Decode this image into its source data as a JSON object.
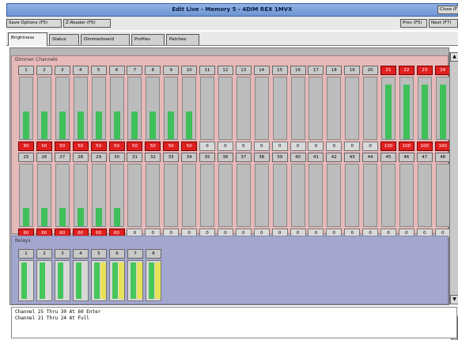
{
  "window": {
    "title": "Edit Live - Memory 5 - 4DIM REX 1MVX"
  },
  "toolbar": {
    "close_label": "Close (F)",
    "save_label": "Save Options (F5)",
    "zreader_label": "Z-Reader (F6)",
    "prev_label": "Prev (F5)",
    "next_label": "Next (F7)"
  },
  "tabs": [
    {
      "label": "Brightness",
      "active": true
    },
    {
      "label": "Status",
      "active": false
    },
    {
      "label": "Dimmerboard",
      "active": false
    },
    {
      "label": "Profiles",
      "active": false
    },
    {
      "label": "Patches",
      "active": false
    }
  ],
  "dimmer_section": {
    "label": "Dimmer Channels"
  },
  "channels_row1": [
    {
      "num": "1",
      "val": "50",
      "level": 0.45,
      "red": true
    },
    {
      "num": "2",
      "val": "50",
      "level": 0.45,
      "red": true
    },
    {
      "num": "3",
      "val": "50",
      "level": 0.45,
      "red": true
    },
    {
      "num": "4",
      "val": "50",
      "level": 0.45,
      "red": true
    },
    {
      "num": "5",
      "val": "50",
      "level": 0.45,
      "red": true
    },
    {
      "num": "6",
      "val": "50",
      "level": 0.45,
      "red": true
    },
    {
      "num": "7",
      "val": "50",
      "level": 0.45,
      "red": true
    },
    {
      "num": "8",
      "val": "50",
      "level": 0.45,
      "red": true
    },
    {
      "num": "9",
      "val": "50",
      "level": 0.45,
      "red": true
    },
    {
      "num": "10",
      "val": "50",
      "level": 0.45,
      "red": true
    },
    {
      "num": "11",
      "val": "0",
      "level": 0,
      "red": false
    },
    {
      "num": "12",
      "val": "0",
      "level": 0,
      "red": false
    },
    {
      "num": "13",
      "val": "0",
      "level": 0,
      "red": false
    },
    {
      "num": "14",
      "val": "0",
      "level": 0,
      "red": false
    },
    {
      "num": "15",
      "val": "0",
      "level": 0,
      "red": false
    },
    {
      "num": "16",
      "val": "0",
      "level": 0,
      "red": false
    },
    {
      "num": "17",
      "val": "0",
      "level": 0,
      "red": false
    },
    {
      "num": "18",
      "val": "0",
      "level": 0,
      "red": false
    },
    {
      "num": "19",
      "val": "0",
      "level": 0,
      "red": false
    },
    {
      "num": "20",
      "val": "0",
      "level": 0,
      "red": false
    },
    {
      "num": "21",
      "val": "100",
      "level": 0.88,
      "red": true,
      "numred": true
    },
    {
      "num": "22",
      "val": "100",
      "level": 0.88,
      "red": true,
      "numred": true
    },
    {
      "num": "23",
      "val": "100",
      "level": 0.88,
      "red": true,
      "numred": true
    },
    {
      "num": "24",
      "val": "100",
      "level": 0.88,
      "red": true,
      "numred": true
    }
  ],
  "channels_row2": [
    {
      "num": "25",
      "val": "60",
      "level": 0.3,
      "red": true
    },
    {
      "num": "26",
      "val": "60",
      "level": 0.3,
      "red": true
    },
    {
      "num": "27",
      "val": "60",
      "level": 0.3,
      "red": true
    },
    {
      "num": "28",
      "val": "60",
      "level": 0.3,
      "red": true
    },
    {
      "num": "29",
      "val": "60",
      "level": 0.3,
      "red": true
    },
    {
      "num": "30",
      "val": "60",
      "level": 0.3,
      "red": true
    },
    {
      "num": "31",
      "val": "0",
      "level": 0,
      "red": false
    },
    {
      "num": "32",
      "val": "0",
      "level": 0,
      "red": false
    },
    {
      "num": "33",
      "val": "0",
      "level": 0,
      "red": false
    },
    {
      "num": "34",
      "val": "0",
      "level": 0,
      "red": false
    },
    {
      "num": "35",
      "val": "0",
      "level": 0,
      "red": false
    },
    {
      "num": "36",
      "val": "0",
      "level": 0,
      "red": false
    },
    {
      "num": "37",
      "val": "0",
      "level": 0,
      "red": false
    },
    {
      "num": "38",
      "val": "0",
      "level": 0,
      "red": false
    },
    {
      "num": "39",
      "val": "0",
      "level": 0,
      "red": false
    },
    {
      "num": "40",
      "val": "0",
      "level": 0,
      "red": false
    },
    {
      "num": "41",
      "val": "0",
      "level": 0,
      "red": false
    },
    {
      "num": "42",
      "val": "0",
      "level": 0,
      "red": false
    },
    {
      "num": "43",
      "val": "0",
      "level": 0,
      "red": false
    },
    {
      "num": "44",
      "val": "0",
      "level": 0,
      "red": false
    },
    {
      "num": "45",
      "val": "0",
      "level": 0,
      "red": false
    },
    {
      "num": "46",
      "val": "0",
      "level": 0,
      "red": false
    },
    {
      "num": "47",
      "val": "0",
      "level": 0,
      "red": false
    },
    {
      "num": "48",
      "val": "0",
      "level": 0,
      "red": false
    }
  ],
  "relay_section": {
    "label": "Relays"
  },
  "relays": [
    {
      "num": "1",
      "yellow": false
    },
    {
      "num": "2",
      "yellow": false
    },
    {
      "num": "3",
      "yellow": false
    },
    {
      "num": "4",
      "yellow": false
    },
    {
      "num": "5",
      "yellow": true
    },
    {
      "num": "6",
      "yellow": true
    },
    {
      "num": "7",
      "yellow": true
    },
    {
      "num": "8",
      "yellow": true
    }
  ],
  "log": [
    "Channel 25 Thru 30 At 60 Enter",
    "Channel 21 Thru 24 At Full"
  ],
  "colors": {
    "level_green": "#3fc05a",
    "alert_red": "#e02020",
    "relay_yellow": "#e7e25a"
  }
}
